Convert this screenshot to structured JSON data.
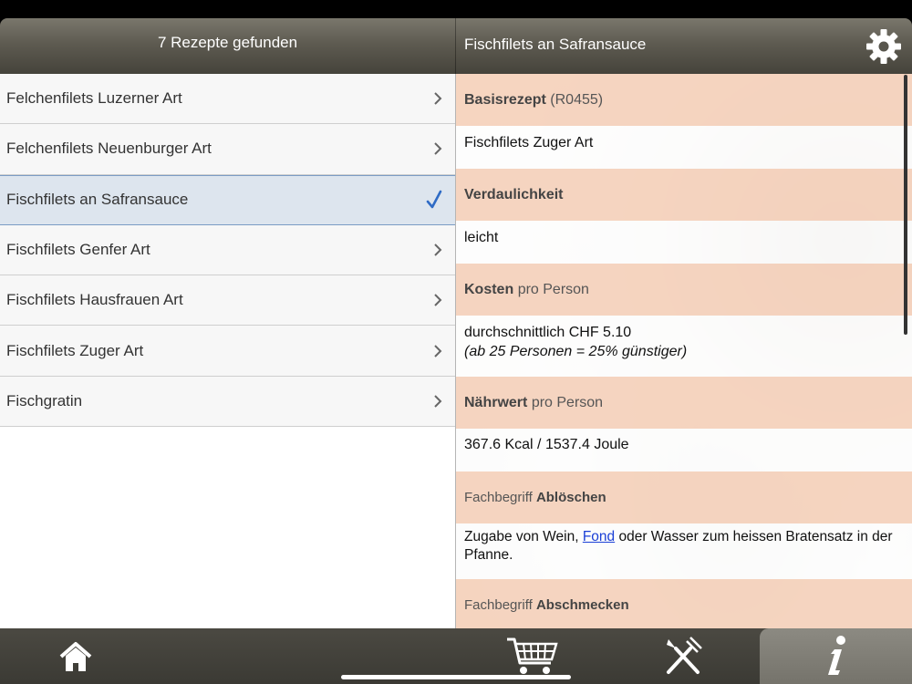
{
  "header": {
    "list_title": "7 Rezepte gefunden",
    "detail_title": "Fischfilets an Safransauce"
  },
  "recipes": [
    {
      "label": "Felchenfilets Luzerner Art"
    },
    {
      "label": "Felchenfilets Neuenburger Art"
    },
    {
      "label": "Fischfilets an Safransauce",
      "selected": true
    },
    {
      "label": "Fischfilets Genfer Art"
    },
    {
      "label": "Fischfilets Hausfrauen Art"
    },
    {
      "label": "Fischfilets Zuger Art"
    },
    {
      "label": "Fischgratin"
    }
  ],
  "detail": {
    "basis": {
      "title": "Basisrezept",
      "code": "(R0455)",
      "value": "Fischfilets Zuger Art"
    },
    "verdau": {
      "title": "Verdaulichkeit",
      "value": "leicht"
    },
    "kosten": {
      "title": "Kosten",
      "suffix": "pro Person",
      "value": "durchschnittlich CHF 5.10",
      "note": "(ab 25 Personen = 25% günstiger)"
    },
    "naehr": {
      "title": "Nährwert",
      "suffix": "pro Person",
      "value": "367.6 Kcal / 1537.4 Joule"
    },
    "fach1": {
      "prefix": "Fachbegriff",
      "term": "Ablöschen",
      "text_before": "Zugabe von Wein, ",
      "link": "Fond",
      "text_after": " oder Wasser zum heissen Bratensatz in der Pfanne."
    },
    "fach2": {
      "prefix": "Fachbegriff",
      "term": "Abschmecken"
    }
  },
  "tabs": [
    {
      "icon": "home-icon"
    },
    {
      "icon": "shopping-cart-icon"
    },
    {
      "icon": "fork-knife-icon"
    },
    {
      "icon": "info-icon",
      "active": true
    }
  ],
  "colors": {
    "section_header": "#f5d2bc",
    "selected_row": "#dde5ee",
    "check": "#2f6bc5",
    "link": "#1a3fd6"
  }
}
